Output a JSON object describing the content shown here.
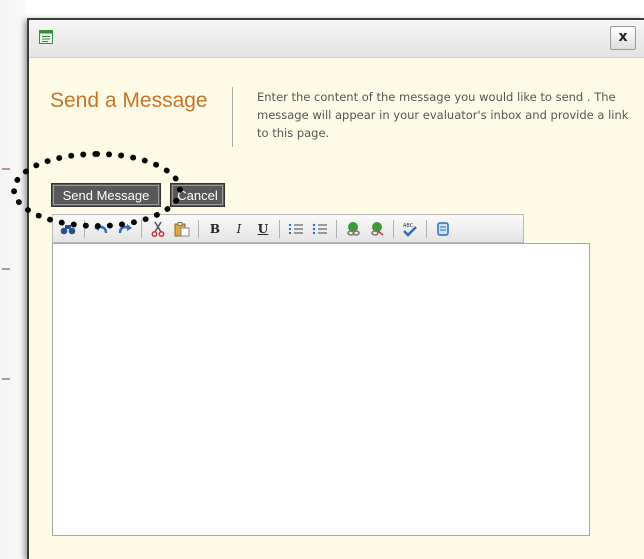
{
  "dialog": {
    "close_label": "x",
    "heading": "Send a Message",
    "description": "Enter the content of the message you would like to send . The message will appear in your evaluator's inbox and provide a link to this page."
  },
  "actions": {
    "send_label": "Send Message",
    "cancel_label": "Cancel"
  },
  "toolbar": {
    "buttons": [
      {
        "name": "find-icon"
      },
      {
        "name": "undo-icon"
      },
      {
        "name": "redo-icon"
      },
      {
        "name": "cut-icon"
      },
      {
        "name": "paste-icon"
      },
      {
        "name": "bold-icon",
        "glyph": "B"
      },
      {
        "name": "italic-icon",
        "glyph": "I"
      },
      {
        "name": "underline-icon",
        "glyph": "U"
      },
      {
        "name": "numbered-list-icon"
      },
      {
        "name": "bulleted-list-icon"
      },
      {
        "name": "insert-link-icon"
      },
      {
        "name": "remove-link-icon"
      },
      {
        "name": "spellcheck-icon"
      },
      {
        "name": "html-source-icon"
      }
    ]
  },
  "editor": {
    "content": ""
  },
  "colors": {
    "heading": "#c8732a",
    "dialog_bg": "#fdfbe6",
    "button_bg": "#595959",
    "annotation": "#050505"
  }
}
